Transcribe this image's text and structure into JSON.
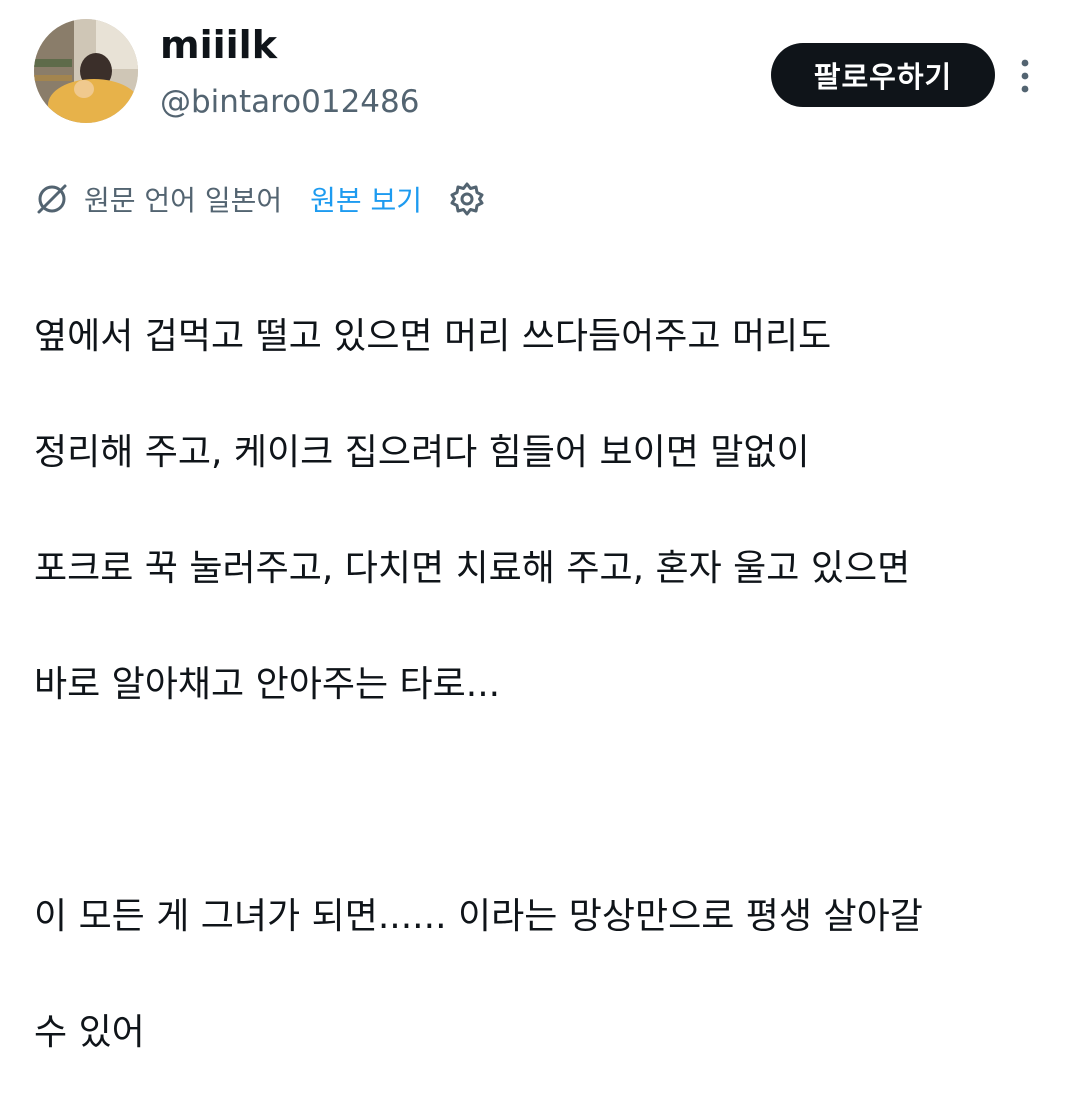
{
  "user": {
    "display_name": "miiilk",
    "handle": "@bintaro012486"
  },
  "actions": {
    "follow_label": "팔로우하기"
  },
  "translation": {
    "original_language": "원문 언어 일본어",
    "show_original_label": "원본 보기"
  },
  "tweet": {
    "lines": [
      "옆에서 겁먹고 떨고 있으면 머리 쓰다듬어주고 머리도",
      "정리해 주고, 케이크 집으려다 힘들어 보이면 말없이",
      "포크로 꾹 눌러주고, 다치면 치료해 주고, 혼자 울고 있으면",
      "바로 알아채고 안아주는 타로...",
      "",
      "이 모든 게 그녀가 되면...... 이라는 망상만으로 평생 살아갈",
      "수 있어"
    ]
  },
  "icons": {
    "translate": "translate-icon",
    "settings": "gear-icon",
    "more": "more-vertical-icon"
  },
  "colors": {
    "text": "#0f1419",
    "secondary": "#536471",
    "link": "#1d9bf0",
    "button_bg": "#0f1419"
  }
}
